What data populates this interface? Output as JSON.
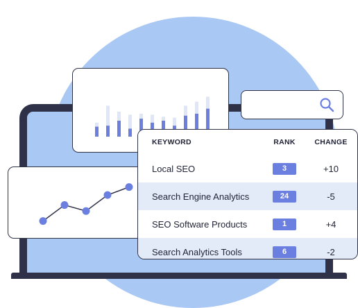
{
  "colors": {
    "background_circle": "#a9c8f3",
    "device_frame": "#2e3148",
    "bar_dark": "#6b7fe0",
    "bar_light": "#dfe6f7",
    "row_shade": "#e4ebf8",
    "badge": "#6b7fe0"
  },
  "search": {
    "icon": "search-icon"
  },
  "bar_widget": {
    "bars": [
      {
        "light": 0.28,
        "dark": 0.2
      },
      {
        "light": 0.62,
        "dark": 0.22
      },
      {
        "light": 0.5,
        "dark": 0.32
      },
      {
        "light": 0.44,
        "dark": 0.16
      },
      {
        "light": 0.46,
        "dark": 0.36
      },
      {
        "light": 0.44,
        "dark": 0.28
      },
      {
        "light": 0.4,
        "dark": 0.32
      },
      {
        "light": 0.38,
        "dark": 0.22
      },
      {
        "light": 0.62,
        "dark": 0.42
      },
      {
        "light": 0.7,
        "dark": 0.46
      },
      {
        "light": 0.8,
        "dark": 0.56
      }
    ]
  },
  "line_widget": {
    "points": [
      0.2,
      0.52,
      0.4,
      0.72,
      0.88
    ]
  },
  "table": {
    "headers": {
      "keyword": "KEYWORD",
      "rank": "RANK",
      "change": "CHANGE"
    },
    "rows": [
      {
        "keyword": "Local SEO",
        "rank": "3",
        "change": "+10"
      },
      {
        "keyword": "Search Engine Analytics",
        "rank": "24",
        "change": "-5"
      },
      {
        "keyword": "SEO Software Products",
        "rank": "1",
        "change": "+4"
      },
      {
        "keyword": "Search Analytics Tools",
        "rank": "6",
        "change": "-2"
      }
    ]
  }
}
